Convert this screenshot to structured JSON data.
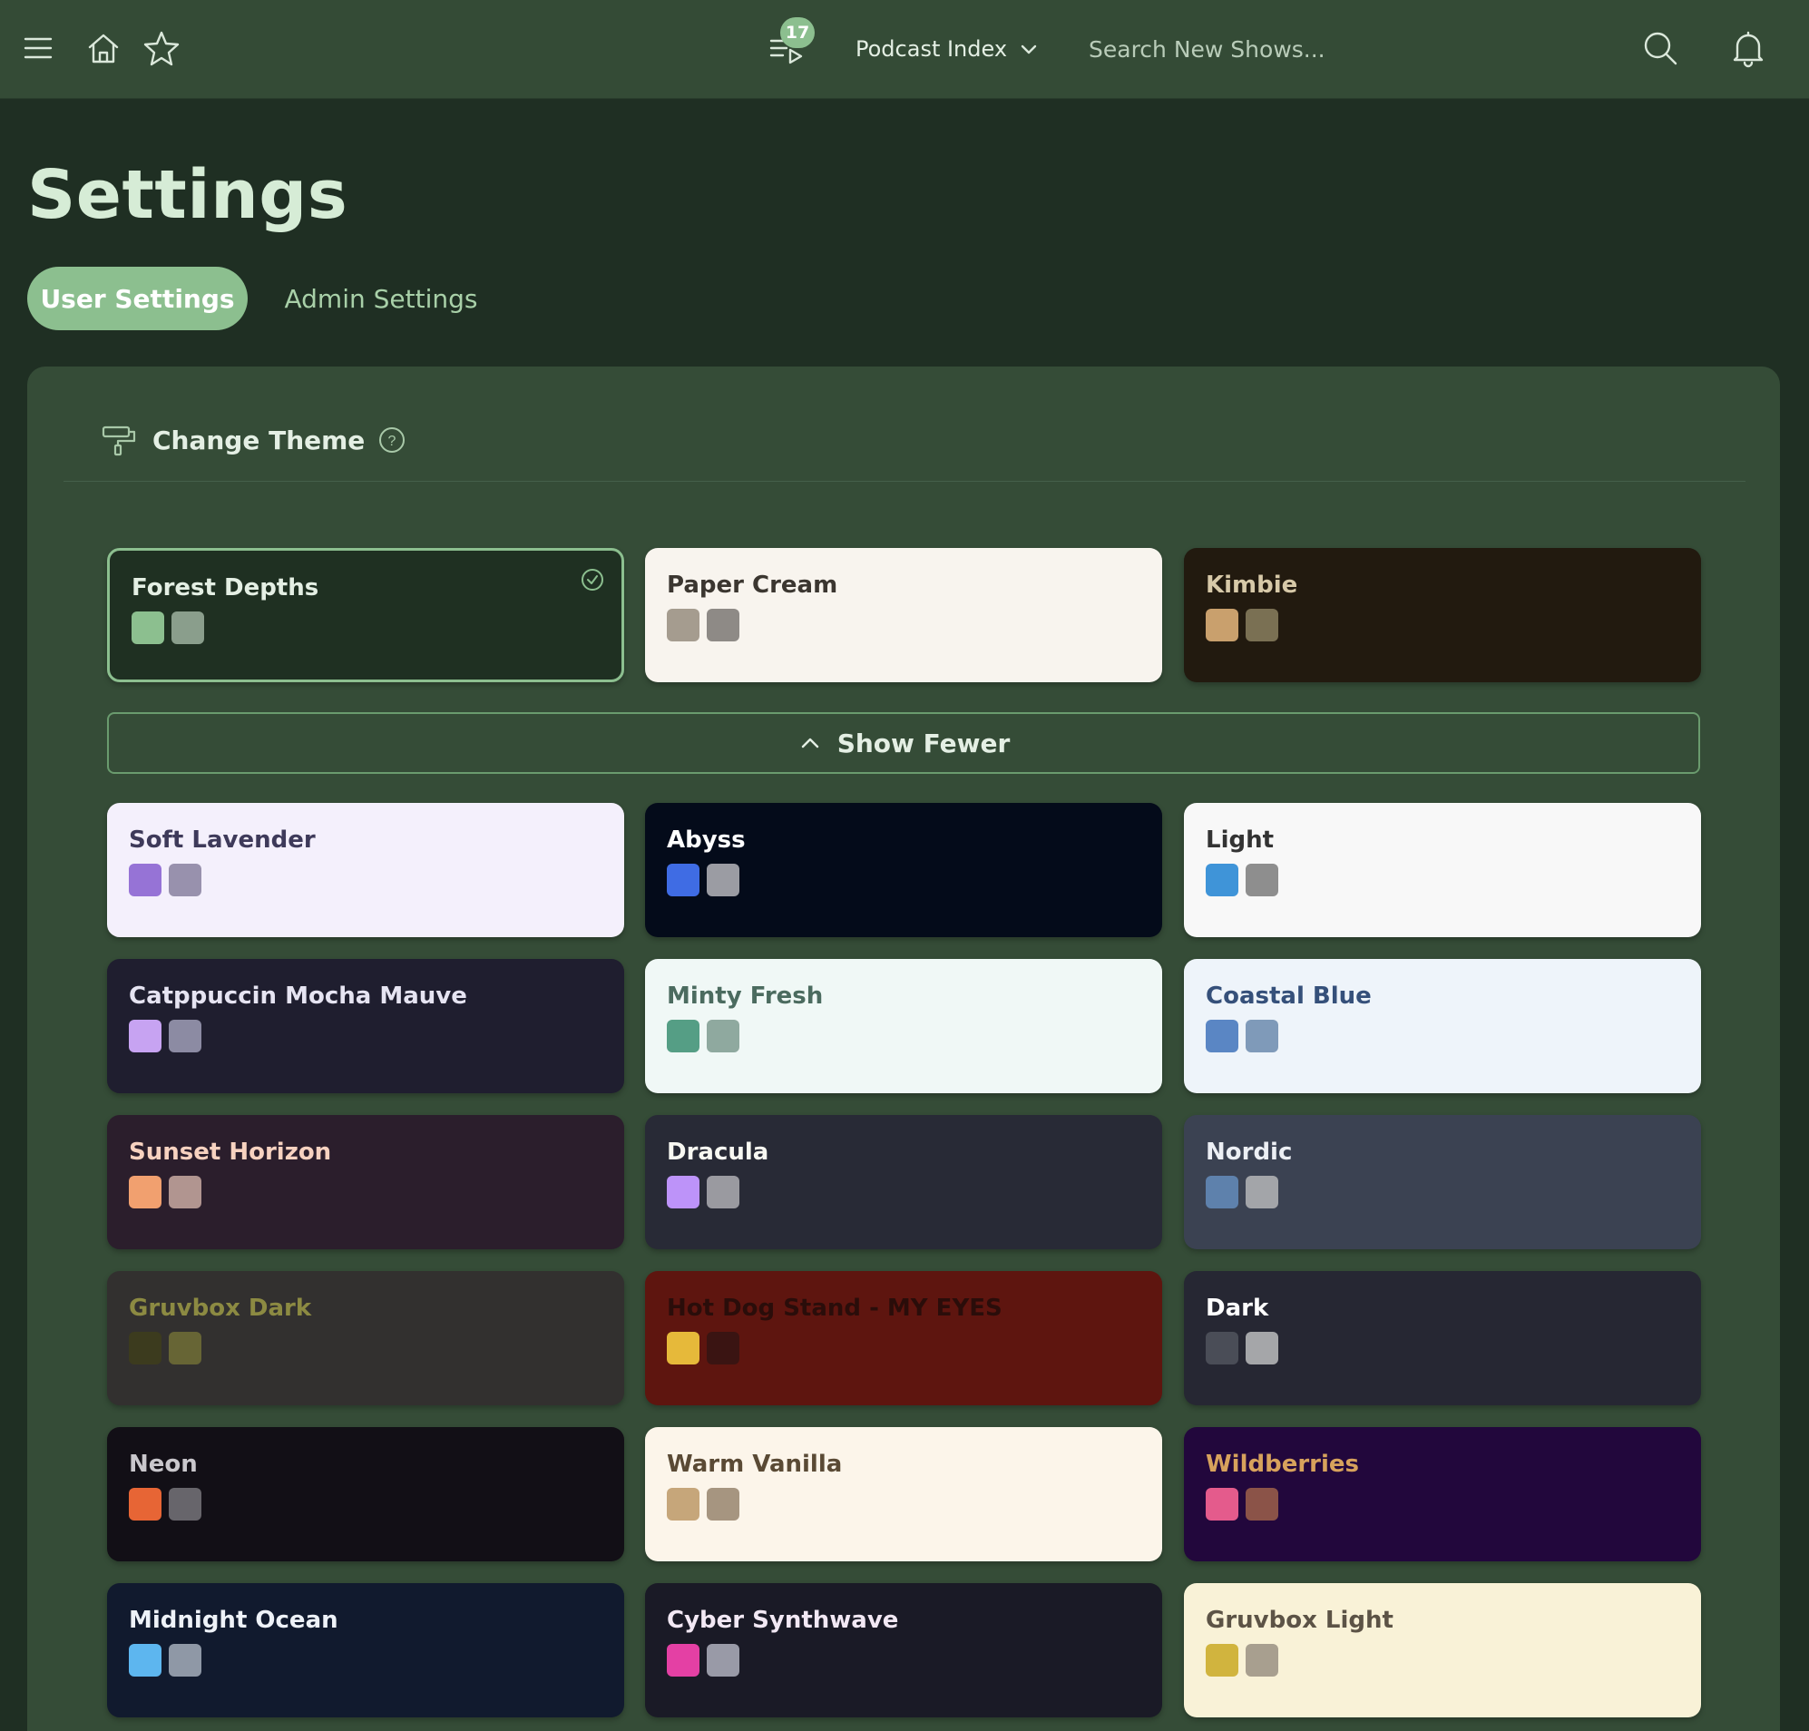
{
  "header": {
    "queue_count": "17",
    "podcast_selector_label": "Podcast Index",
    "search_placeholder": "Search New Shows..."
  },
  "page": {
    "title": "Settings",
    "tabs": [
      {
        "label": "User Settings",
        "active": true
      },
      {
        "label": "Admin Settings",
        "active": false
      }
    ]
  },
  "theme_section": {
    "title": "Change Theme",
    "show_fewer_label": "Show Fewer",
    "selected": "Forest Depths",
    "themes": [
      {
        "name": "Forest Depths",
        "bg": "#1f3022",
        "fg": "#e4efe4",
        "swatches": [
          "#8cbf8f",
          "#8a9e8c"
        ]
      },
      {
        "name": "Paper Cream",
        "bg": "#f8f4ee",
        "fg": "#3b3630",
        "swatches": [
          "#a59c8f",
          "#8e8a86"
        ]
      },
      {
        "name": "Kimbie",
        "bg": "#221a0f",
        "fg": "#d7c9a8",
        "swatches": [
          "#c9a06d",
          "#7a7053"
        ]
      },
      {
        "name": "Soft Lavender",
        "bg": "#f4f0fc",
        "fg": "#3e3a5a",
        "swatches": [
          "#9673d6",
          "#9891ad"
        ]
      },
      {
        "name": "Abyss",
        "bg": "#040b1a",
        "fg": "#ffffff",
        "swatches": [
          "#3f6ce4",
          "#9b9ca3"
        ]
      },
      {
        "name": "Light",
        "bg": "#f8f8f8",
        "fg": "#333333",
        "swatches": [
          "#3f94d8",
          "#8e8e8e"
        ]
      },
      {
        "name": "Catppuccin Mocha Mauve",
        "bg": "#1f1e2f",
        "fg": "#e6e4f2",
        "swatches": [
          "#c7a3f2",
          "#8c8ba3"
        ]
      },
      {
        "name": "Minty Fresh",
        "bg": "#f0f8f6",
        "fg": "#4b6b5f",
        "swatches": [
          "#559e85",
          "#8fa99f"
        ]
      },
      {
        "name": "Coastal Blue",
        "bg": "#eef4fa",
        "fg": "#35507a",
        "swatches": [
          "#5a86c4",
          "#7f9ab9"
        ]
      },
      {
        "name": "Sunset Horizon",
        "bg": "#2b1e2c",
        "fg": "#f7d2c0",
        "swatches": [
          "#f1a06f",
          "#b19590"
        ]
      },
      {
        "name": "Dracula",
        "bg": "#282a36",
        "fg": "#f8f8f2",
        "swatches": [
          "#bd93f9",
          "#9a9aa0"
        ]
      },
      {
        "name": "Nordic",
        "bg": "#3b4252",
        "fg": "#eceff4",
        "swatches": [
          "#5e81ac",
          "#a3a5a9"
        ]
      },
      {
        "name": "Gruvbox Dark",
        "bg": "#32302f",
        "fg": "#8c8a42",
        "swatches": [
          "#3c3b1e",
          "#676535"
        ]
      },
      {
        "name": "Hot Dog Stand - MY EYES",
        "bg": "#5e150f",
        "fg": "#2a0d0a",
        "swatches": [
          "#e6b93a",
          "#3a1412"
        ]
      },
      {
        "name": "Dark",
        "bg": "#262733",
        "fg": "#ffffff",
        "swatches": [
          "#4a4d57",
          "#a5a6a9"
        ]
      },
      {
        "name": "Neon",
        "bg": "#120f16",
        "fg": "#c9c7cc",
        "swatches": [
          "#e76535",
          "#67656b"
        ]
      },
      {
        "name": "Warm Vanilla",
        "bg": "#fcf5ea",
        "fg": "#5a4a35",
        "swatches": [
          "#c6a67a",
          "#a69580"
        ]
      },
      {
        "name": "Wildberries",
        "bg": "#22073c",
        "fg": "#d7a25c",
        "swatches": [
          "#e45b8c",
          "#8b5348"
        ]
      },
      {
        "name": "Midnight Ocean",
        "bg": "#111a2e",
        "fg": "#eef2f8",
        "swatches": [
          "#5db6ef",
          "#8f98a6"
        ]
      },
      {
        "name": "Cyber Synthwave",
        "bg": "#1a1a26",
        "fg": "#f2e8f4",
        "swatches": [
          "#e440a4",
          "#999aa7"
        ]
      },
      {
        "name": "Gruvbox Light",
        "bg": "#f9f2d7",
        "fg": "#5c5346",
        "swatches": [
          "#d1b43e",
          "#a89f8f"
        ]
      }
    ]
  }
}
